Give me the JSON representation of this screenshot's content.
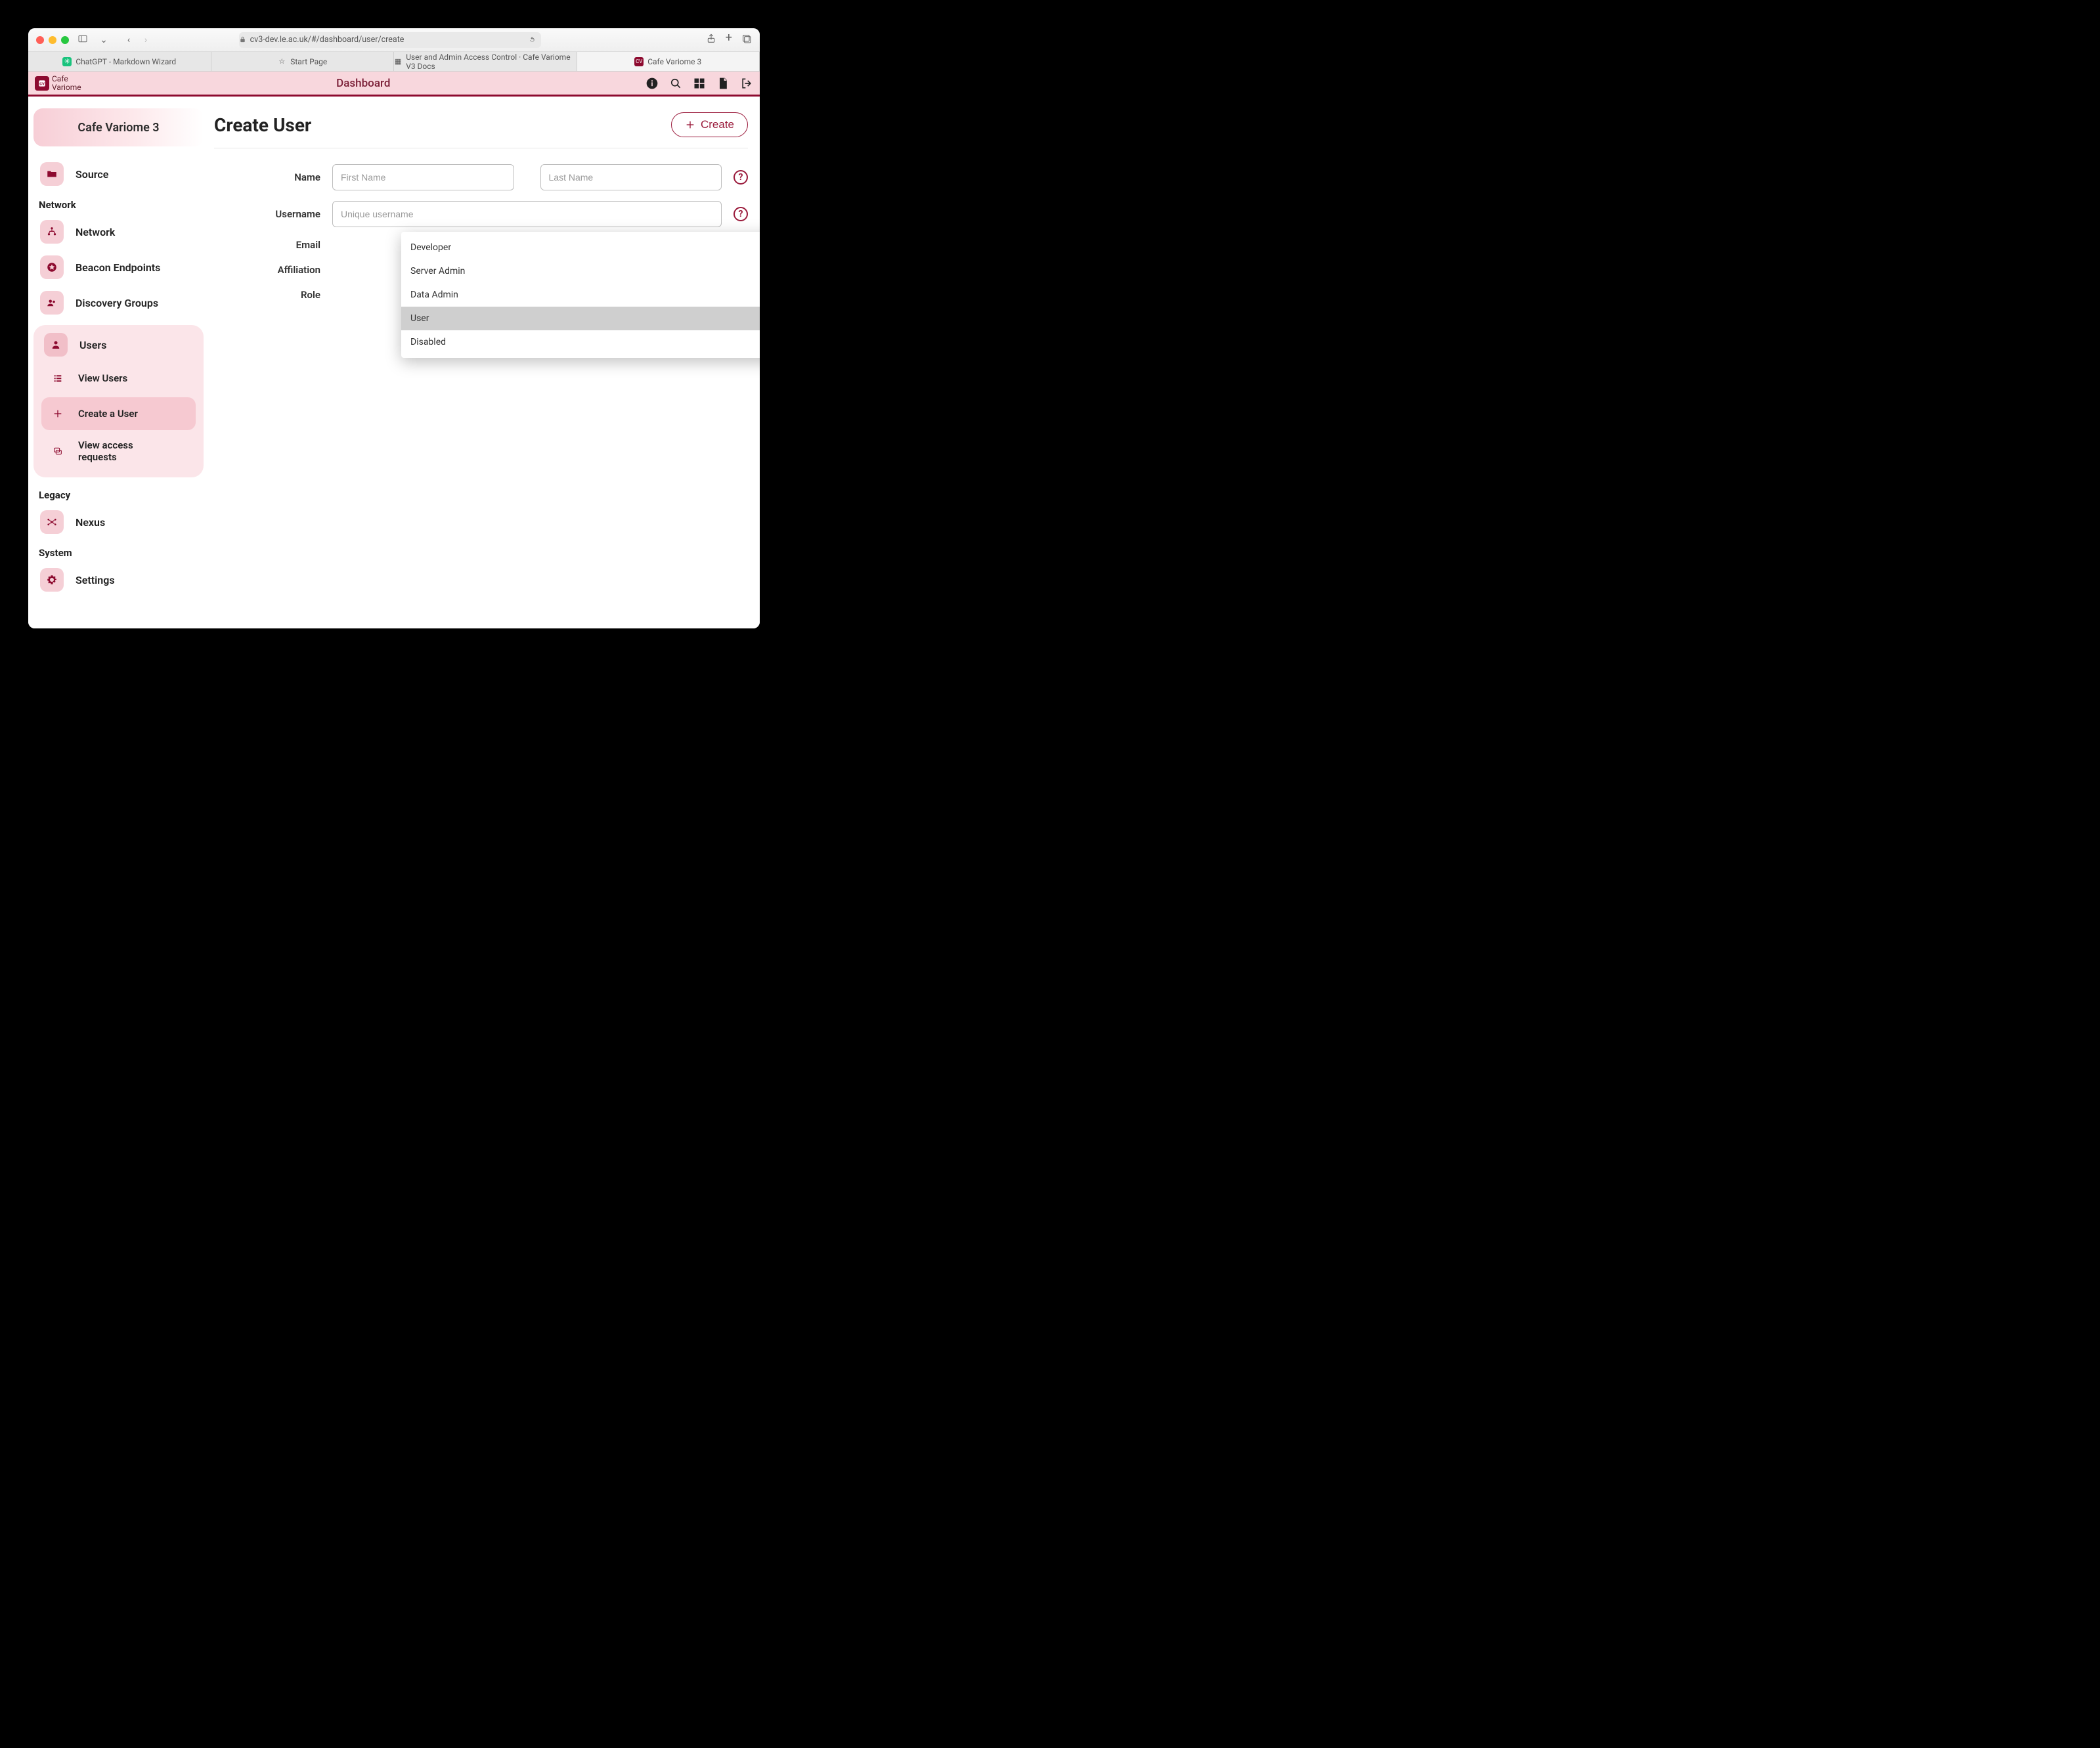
{
  "browser": {
    "url": "cv3-dev.le.ac.uk/#/dashboard/user/create",
    "tabs": [
      {
        "label": "ChatGPT - Markdown Wizard"
      },
      {
        "label": "Start Page"
      },
      {
        "label": "User and Admin Access Control · Cafe Variome V3 Docs"
      },
      {
        "label": "Cafe Variome 3"
      }
    ]
  },
  "header": {
    "brand_line1": "Cafe",
    "brand_line2": "Variome",
    "title": "Dashboard"
  },
  "sidebar": {
    "site_name": "Cafe Variome 3",
    "items": {
      "source": "Source",
      "network_group": "Network",
      "network": "Network",
      "beacon": "Beacon Endpoints",
      "discovery": "Discovery Groups",
      "users": "Users",
      "view_users": "View Users",
      "create_user": "Create a User",
      "view_requests": "View access requests",
      "legacy_group": "Legacy",
      "nexus": "Nexus",
      "system_group": "System",
      "settings": "Settings"
    }
  },
  "page": {
    "title": "Create User",
    "create_btn": "Create",
    "labels": {
      "name": "Name",
      "username": "Username",
      "email": "Email",
      "affiliation": "Affiliation",
      "role": "Role"
    },
    "placeholders": {
      "first_name": "First Name",
      "last_name": "Last Name",
      "username": "Unique username"
    },
    "role_options": [
      "Developer",
      "Server Admin",
      "Data Admin",
      "User",
      "Disabled"
    ],
    "role_selected": "User"
  }
}
